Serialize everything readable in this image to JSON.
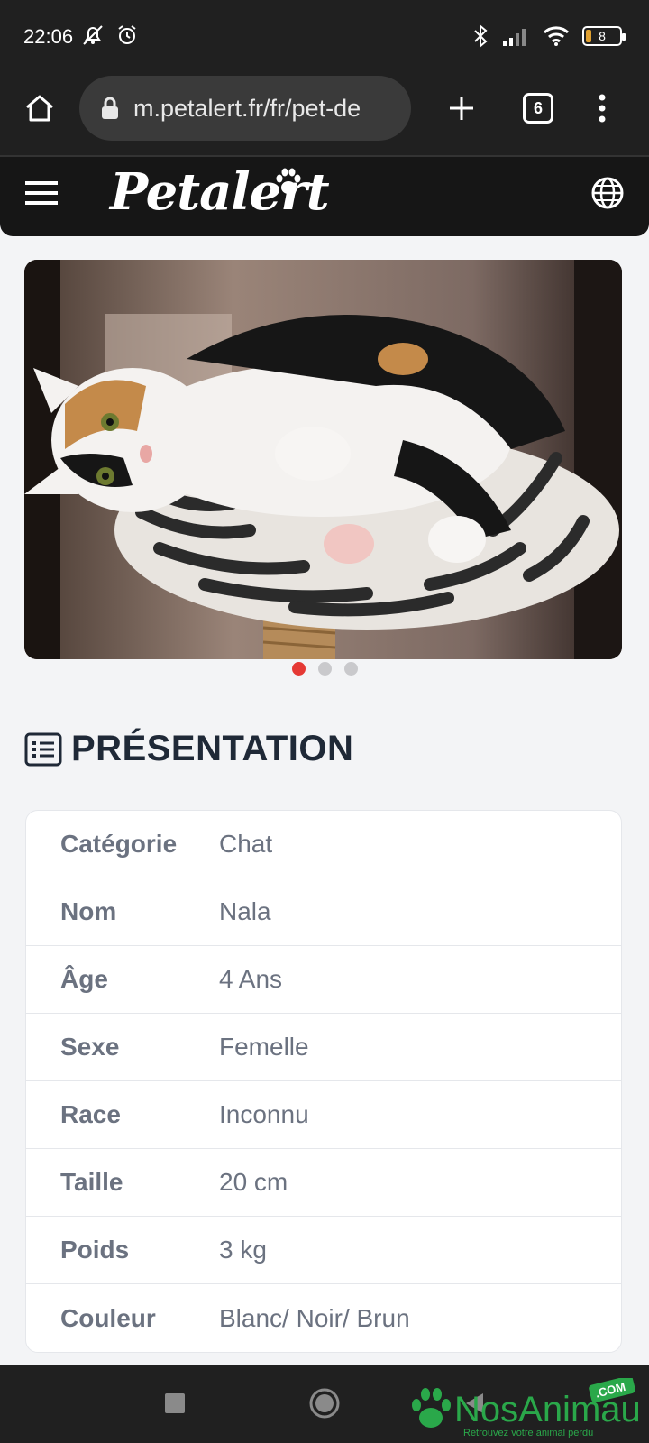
{
  "status": {
    "time": "22:06",
    "battery": "8"
  },
  "browser": {
    "url": "m.petalert.fr/fr/pet-de",
    "tab_count": "6"
  },
  "site": {
    "logo": "Petalert"
  },
  "carousel": {
    "dots": 3,
    "active_index": 0
  },
  "presentation": {
    "title": "PRÉSENTATION",
    "rows": [
      {
        "key": "Catégorie",
        "value": "Chat"
      },
      {
        "key": "Nom",
        "value": "Nala"
      },
      {
        "key": "Âge",
        "value": "4 Ans"
      },
      {
        "key": "Sexe",
        "value": "Femelle"
      },
      {
        "key": "Race",
        "value": "Inconnu"
      },
      {
        "key": "Taille",
        "value": "20 cm"
      },
      {
        "key": "Poids",
        "value": "3 kg"
      },
      {
        "key": "Couleur",
        "value": "Blanc/ Noir/ Brun"
      }
    ]
  },
  "watermark": {
    "brand": "NosAnimaux",
    "tld": ".COM",
    "tagline": "Retrouvez votre animal perdu"
  }
}
